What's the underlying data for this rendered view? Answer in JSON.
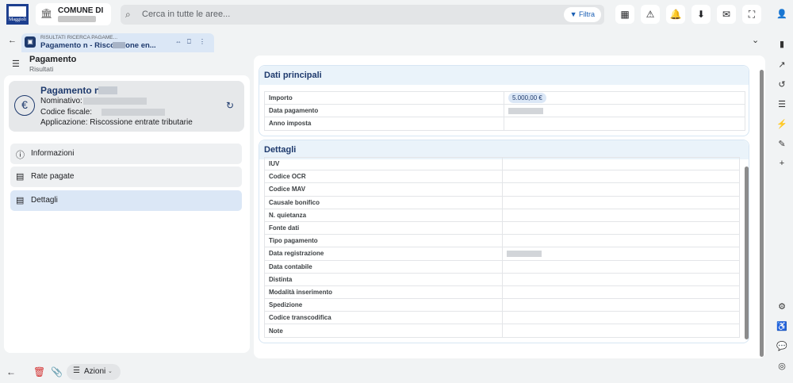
{
  "header": {
    "org_title": "COMUNE DI",
    "logo_text": "Maggioli",
    "search_placeholder": "Cerca in tutte le aree...",
    "filter_label": "Filtra"
  },
  "tab": {
    "subtitle": "RISULTATI RICERCA PAGAME...",
    "title": "Pagamento n         - Riscossione en..."
  },
  "left": {
    "breadcrumb_title": "Pagamento",
    "breadcrumb_sub": "Risultati",
    "summary_title": "Pagamento n",
    "nominativo_label": "Nominativo:",
    "codice_fiscale_label": "Codice fiscale:",
    "applicazione_line": "Applicazione: Riscossione entrate tributarie",
    "nav": [
      {
        "label": "Informazioni",
        "icon": "info-icon"
      },
      {
        "label": "Rate pagate",
        "icon": "document-icon"
      },
      {
        "label": "Dettagli",
        "icon": "details-icon"
      }
    ]
  },
  "main": {
    "dati_principali": {
      "title": "Dati principali",
      "rows": [
        {
          "label": "Importo",
          "value": "5.000,00 €"
        },
        {
          "label": "Data pagamento",
          "value": ""
        },
        {
          "label": "Anno imposta",
          "value": ""
        }
      ]
    },
    "dettagli": {
      "title": "Dettagli",
      "rows": [
        "IUV",
        "Codice OCR",
        "Codice MAV",
        "Causale bonifico",
        "N. quietanza",
        "Fonte dati",
        "Tipo pagamento",
        "Data registrazione",
        "Data contabile",
        "Distinta",
        "Modalità inserimento",
        "Spedizione",
        "Codice transcodifica",
        "Note"
      ]
    }
  },
  "bottom": {
    "azioni_label": "Azioni"
  },
  "colors": {
    "accent": "#1e3a6d",
    "selected": "#dbe7f6",
    "section_header": "#eaf3fa"
  }
}
